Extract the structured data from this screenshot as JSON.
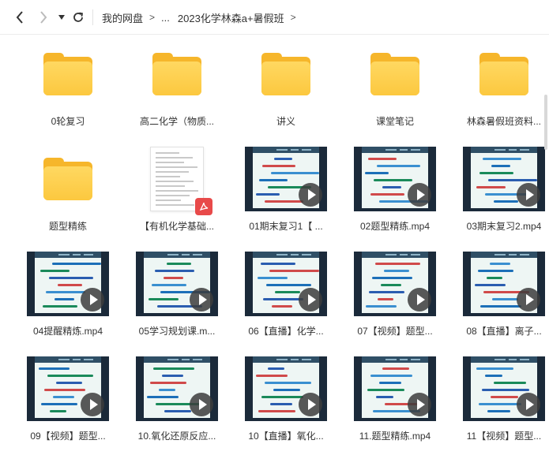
{
  "nav": {
    "back_icon": "chevron-left-icon",
    "forward_icon": "chevron-right-icon",
    "history_dropdown_icon": "caret-down-icon",
    "refresh_icon": "refresh-icon"
  },
  "breadcrumb": {
    "items": [
      "我的网盘",
      "...",
      "2023化学林森a+暑假班"
    ],
    "separator": ">"
  },
  "colors": {
    "folder": "#fcc83f",
    "pdf": "#e84a4a",
    "play_button": "#3c3c3c"
  },
  "files": [
    {
      "name": "0轮复习",
      "type": "folder"
    },
    {
      "name": "高二化学（物质...",
      "type": "folder"
    },
    {
      "name": "讲义",
      "type": "folder"
    },
    {
      "name": "课堂笔记",
      "type": "folder"
    },
    {
      "name": "林森暑假班资料...",
      "type": "folder"
    },
    {
      "name": "题型精练",
      "type": "folder"
    },
    {
      "name": "【有机化学基础...",
      "type": "pdf"
    },
    {
      "name": "01期末复习1【 ...",
      "type": "video"
    },
    {
      "name": "02题型精练.mp4",
      "type": "video"
    },
    {
      "name": "03期末复习2.mp4",
      "type": "video"
    },
    {
      "name": "04提醒精炼.mp4",
      "type": "video"
    },
    {
      "name": "05学习规划课.m...",
      "type": "video"
    },
    {
      "name": "06【直播】化学...",
      "type": "video"
    },
    {
      "name": "07【视频】题型...",
      "type": "video"
    },
    {
      "name": "08【直播】离子...",
      "type": "video"
    },
    {
      "name": "09【视频】题型...",
      "type": "video"
    },
    {
      "name": "10.氧化还原反应...",
      "type": "video"
    },
    {
      "name": "10【直播】氧化...",
      "type": "video"
    },
    {
      "name": "11.题型精练.mp4",
      "type": "video"
    },
    {
      "name": "11【视频】题型...",
      "type": "video"
    }
  ]
}
